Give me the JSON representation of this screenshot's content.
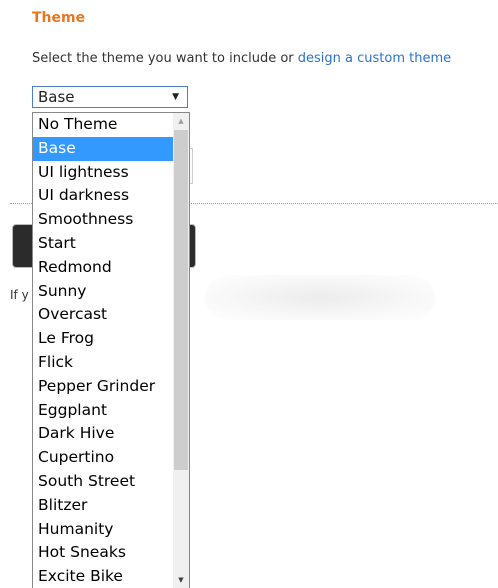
{
  "section": {
    "title": "Theme",
    "intro_text": "Select the theme you want to include or ",
    "custom_theme_link": "design a custom theme"
  },
  "theme_select": {
    "selected": "Base",
    "options": [
      {
        "label": "No Theme",
        "selected": false
      },
      {
        "label": "Base",
        "selected": true
      },
      {
        "label": "UI lightness",
        "selected": false
      },
      {
        "label": "UI darkness",
        "selected": false
      },
      {
        "label": "Smoothness",
        "selected": false
      },
      {
        "label": "Start",
        "selected": false
      },
      {
        "label": "Redmond",
        "selected": false
      },
      {
        "label": "Sunny",
        "selected": false
      },
      {
        "label": "Overcast",
        "selected": false
      },
      {
        "label": "Le Frog",
        "selected": false
      },
      {
        "label": "Flick",
        "selected": false
      },
      {
        "label": "Pepper Grinder",
        "selected": false
      },
      {
        "label": "Eggplant",
        "selected": false
      },
      {
        "label": "Dark Hive",
        "selected": false
      },
      {
        "label": "Cupertino",
        "selected": false
      },
      {
        "label": "South Street",
        "selected": false
      },
      {
        "label": "Blitzer",
        "selected": false
      },
      {
        "label": "Humanity",
        "selected": false
      },
      {
        "label": "Hot Sneaks",
        "selected": false
      },
      {
        "label": "Excite Bike",
        "selected": false
      }
    ]
  },
  "background": {
    "partial_text": "If y"
  },
  "icons": {
    "dropdown": "caret-down-icon",
    "scroll_up": "scroll-up-arrow-icon",
    "scroll_down": "scroll-down-arrow-icon"
  },
  "colors": {
    "heading": "#e87722",
    "link": "#2a73c9",
    "selection": "#3399ff"
  }
}
